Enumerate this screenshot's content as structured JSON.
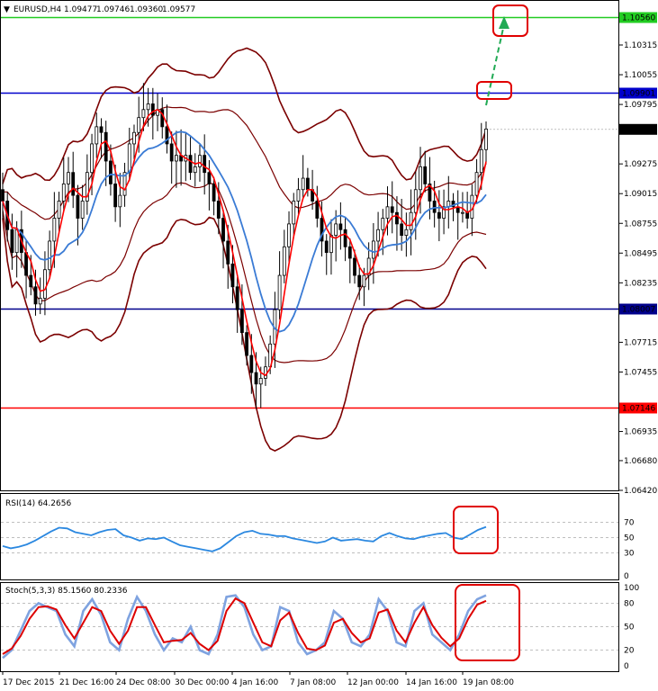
{
  "header": {
    "symbol": "EURUSD,H4",
    "open": "1.09477",
    "high": "1.09746",
    "low": "1.09360",
    "close": "1.09577"
  },
  "rsi": {
    "label": "RSI(14) 64.2656",
    "ticks": [
      "70",
      "50",
      "30",
      "0"
    ],
    "levels": [
      70,
      50,
      30
    ]
  },
  "stoch": {
    "label": "Stoch(5,3,3) 85.1560 80.2336",
    "ticks": [
      "100",
      "80",
      "50",
      "20",
      "0"
    ],
    "levels": [
      80,
      50,
      20
    ]
  },
  "price_ticks": [
    "1.10315",
    "1.10055",
    "1.09795",
    "1.09275",
    "1.09015",
    "1.08755",
    "1.08495",
    "1.08235",
    "1.07715",
    "1.07455",
    "1.06935",
    "1.06680",
    "1.06420"
  ],
  "x_ticks": [
    "17 Dec 2015",
    "21 Dec 16:00",
    "24 Dec 08:00",
    "30 Dec 00:00",
    "4 Jan 16:00",
    "7 Jan 08:00",
    "12 Jan 00:00",
    "14 Jan 16:00",
    "19 Jan 08:00"
  ],
  "hlines": [
    {
      "price": 1.1056,
      "label": "1.10560",
      "color": "#22cc22"
    },
    {
      "price": 1.09901,
      "label": "1.09901",
      "color": "#0000cc"
    },
    {
      "price": 1.08007,
      "label": "1.08007",
      "color": "#00008b"
    },
    {
      "price": 1.07146,
      "label": "1.07146",
      "color": "#ff0000"
    }
  ],
  "last_price": {
    "price": 1.09577,
    "label": "1.09577"
  },
  "colors": {
    "candles": "#000000",
    "bollinger": "#7b0000",
    "ma_fast": "#ff0000",
    "ma_slow": "#3a7bd5",
    "rsi_line": "#2b88e0",
    "stoch_main": "#7fa3e0",
    "stoch_signal": "#dd0000",
    "highlight_box": "#e00000",
    "arrow": "#22aa55"
  },
  "chart_data": {
    "type": "candlestick",
    "symbol": "EURUSD",
    "timeframe": "H4",
    "ylim": [
      1.0642,
      1.1085
    ],
    "ohlc_close": [
      1.0895,
      1.087,
      1.085,
      1.087,
      1.085,
      1.083,
      1.082,
      1.0805,
      1.081,
      1.0835,
      1.086,
      1.088,
      1.0895,
      1.091,
      1.092,
      1.09,
      1.088,
      1.0895,
      1.092,
      1.0945,
      1.096,
      1.0955,
      1.093,
      1.091,
      1.089,
      1.09,
      1.092,
      1.0945,
      1.0955,
      1.0968,
      1.0975,
      1.098,
      1.097,
      1.0975,
      1.096,
      1.0945,
      1.093,
      1.0935,
      1.093,
      1.0935,
      1.092,
      1.0925,
      1.0935,
      1.092,
      1.091,
      1.0895,
      1.088,
      1.086,
      1.084,
      1.082,
      1.08,
      1.078,
      1.076,
      1.0745,
      1.0735,
      1.074,
      1.075,
      1.077,
      1.08,
      1.083,
      1.0855,
      1.0875,
      1.0895,
      1.0905,
      1.0915,
      1.0905,
      1.0895,
      1.088,
      1.086,
      1.085,
      1.0865,
      1.0875,
      1.087,
      1.0855,
      1.0845,
      1.083,
      1.082,
      1.083,
      1.0845,
      1.086,
      1.087,
      1.088,
      1.089,
      1.0885,
      1.0875,
      1.0865,
      1.087,
      1.0885,
      1.0905,
      1.0925,
      1.091,
      1.0895,
      1.0885,
      1.088,
      1.089,
      1.0895,
      1.089,
      1.0885,
      1.0885,
      1.088,
      1.09,
      1.092,
      1.094,
      1.0958
    ],
    "rsi_values": [
      39,
      36,
      38,
      41,
      46,
      52,
      58,
      63,
      62,
      57,
      55,
      53,
      57,
      60,
      61,
      53,
      50,
      46,
      49,
      48,
      50,
      45,
      40,
      38,
      36,
      34,
      32,
      36,
      44,
      52,
      57,
      59,
      55,
      54,
      52,
      52,
      49,
      47,
      45,
      43,
      45,
      50,
      46,
      47,
      48,
      46,
      45,
      52,
      56,
      52,
      49,
      48,
      51,
      53,
      55,
      56,
      50,
      48,
      54,
      60,
      64
    ],
    "stoch_main": [
      10,
      20,
      45,
      70,
      80,
      75,
      70,
      40,
      25,
      70,
      85,
      65,
      30,
      20,
      60,
      88,
      70,
      40,
      20,
      35,
      30,
      50,
      20,
      15,
      40,
      88,
      90,
      75,
      40,
      20,
      25,
      75,
      70,
      30,
      15,
      20,
      30,
      70,
      60,
      30,
      25,
      40,
      85,
      70,
      30,
      25,
      70,
      80,
      40,
      30,
      20,
      40,
      70,
      85,
      90
    ],
    "stoch_signal": [
      15,
      22,
      38,
      60,
      75,
      76,
      72,
      52,
      35,
      55,
      75,
      70,
      45,
      28,
      45,
      75,
      75,
      52,
      30,
      32,
      33,
      42,
      28,
      20,
      32,
      70,
      86,
      80,
      55,
      30,
      25,
      58,
      68,
      42,
      22,
      20,
      26,
      55,
      60,
      42,
      30,
      35,
      68,
      72,
      45,
      30,
      55,
      75,
      52,
      36,
      25,
      35,
      60,
      78,
      83
    ]
  }
}
